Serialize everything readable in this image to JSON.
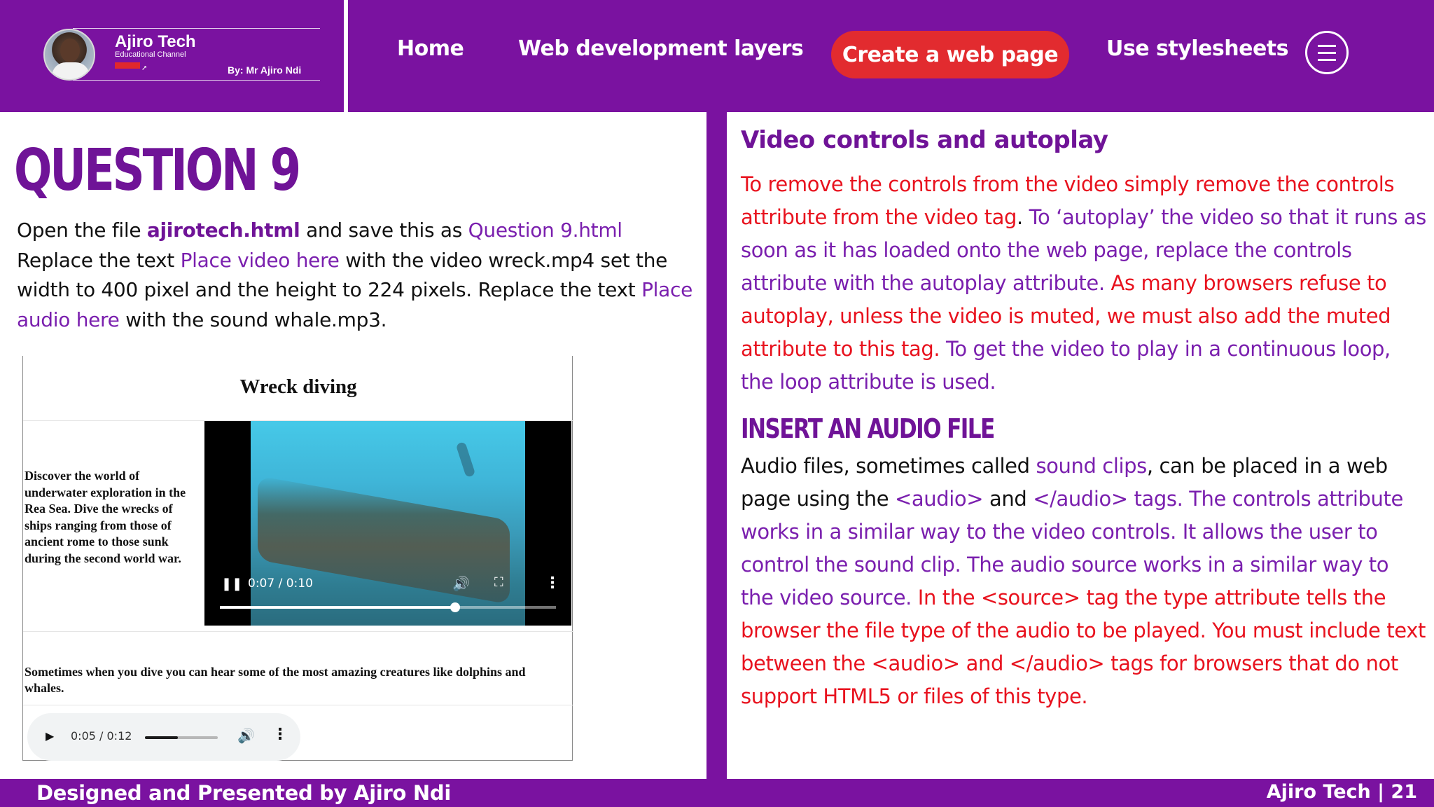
{
  "colors": {
    "brand_purple": "#7a12a0",
    "accent_red": "#e22b2f",
    "text_red": "#e8121e",
    "text_purple": "#7a1fae",
    "background": "#ffffff"
  },
  "header": {
    "logo": {
      "name": "Ajiro Tech",
      "subtitle": "Educational Channel",
      "by": "By: Mr Ajiro Ndi",
      "icon": "avatar-photo"
    },
    "nav": {
      "home": "Home",
      "web_dev_layers": "Web development layers",
      "create_web_page": "Create a web page",
      "use_stylesheets": "Use stylesheets",
      "menu_icon": "hamburger-menu-icon"
    }
  },
  "left": {
    "title": "QUESTION 9",
    "instructions": {
      "t1": "Open the file ",
      "file1": "ajirotech.html",
      "t2": " and save this as ",
      "file2": "Question 9.html",
      "t3": " Replace the text ",
      "placeholder1": "Place video here",
      "t4": " with the video wreck.mp4 set the width to 400 pixel and the height to 224 pixels. Replace the text ",
      "placeholder2": "Place audio here",
      "t5": " with the sound whale.mp3."
    },
    "preview": {
      "heading": "Wreck diving",
      "description": "Discover the world of underwater exploration in the Rea Sea. Dive the wrecks of ships ranging from those of ancient rome to those sunk during the second world war.",
      "video": {
        "time": "0:07 / 0:10",
        "progress": 0.7
      },
      "sound_text": "Sometimes when you dive you can hear some of the most amazing creatures like dolphins and whales.",
      "audio": {
        "time": "0:05 / 0:12",
        "progress": 0.45
      }
    }
  },
  "right": {
    "heading": "Video controls and autoplay",
    "p1": {
      "r1": "To remove the controls from the video simply remove the controls attribute from the video tag",
      "k1": ". ",
      "p1": "To ‘autoplay’ the video so that it runs as soon as it has loaded onto the web page, replace the controls attribute with the autoplay attribute.",
      "r2": " As many browsers refuse to autoplay, unless the video is muted, we must also add the muted attribute to this tag.",
      "p2": " To get the video to play in a continuous loop, the loop attribute is used."
    },
    "heading2": "INSERT AN AUDIO FILE",
    "p2": {
      "k1": "Audio files, sometimes called ",
      "p1": "sound clips",
      "k2": ", can be placed in a web page using the ",
      "p2": "<audio>",
      "k3": " and ",
      "p3": "</audio> tags. The controls attribute works in a similar way to the video controls. It allows the user to control the sound clip. The audio source works in a similar way to the video source.",
      "r1": " In the <source> tag the type attribute tells the browser the file type of the audio to be played. You must include text between the <audio> and </audio> tags for browsers that do not support HTML5 or files of this type."
    }
  },
  "footer": {
    "left": "Designed and Presented by Ajiro Ndi",
    "right": "Ajiro Tech | 21"
  }
}
